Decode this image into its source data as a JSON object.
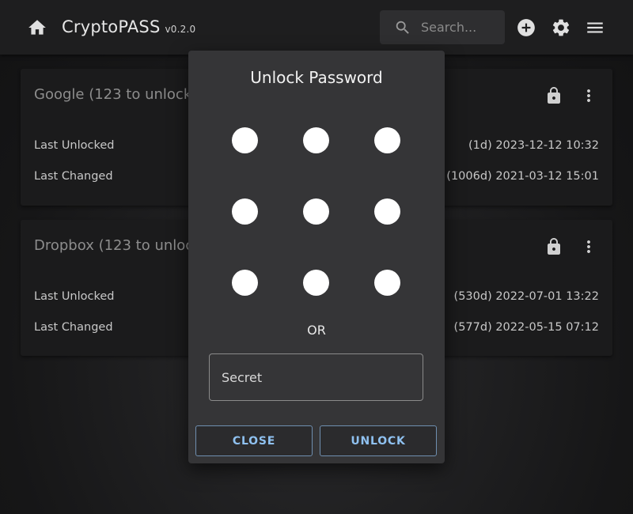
{
  "appbar": {
    "title": "CryptoPASS",
    "version": "v0.2.0",
    "search_placeholder": "Search...",
    "icons": [
      "home-icon",
      "search-icon",
      "add-circle-icon",
      "gear-icon",
      "menu-icon"
    ]
  },
  "cards": [
    {
      "title": "Google (123 to unlock)",
      "rows": [
        {
          "label": "Last Unlocked",
          "value": "(1d) 2023-12-12 10:32"
        },
        {
          "label": "Last Changed",
          "value": "(1006d) 2021-03-12 15:01"
        }
      ]
    },
    {
      "title": "Dropbox (123 to unlock)",
      "rows": [
        {
          "label": "Last Unlocked",
          "value": "(530d) 2022-07-01 13:22"
        },
        {
          "label": "Last Changed",
          "value": "(577d) 2022-05-15 07:12"
        }
      ]
    }
  ],
  "dialog": {
    "title": "Unlock Password",
    "or_label": "OR",
    "secret_placeholder": "Secret",
    "close_label": "CLOSE",
    "unlock_label": "UNLOCK"
  },
  "colors": {
    "appbar_bg": "#1e1e1f",
    "card_bg": "#1b1b1c",
    "dialog_bg": "#353537",
    "button_text": "#8fc1f0",
    "button_border": "#6f8fb0",
    "pattern_dot": "#ffffff"
  }
}
